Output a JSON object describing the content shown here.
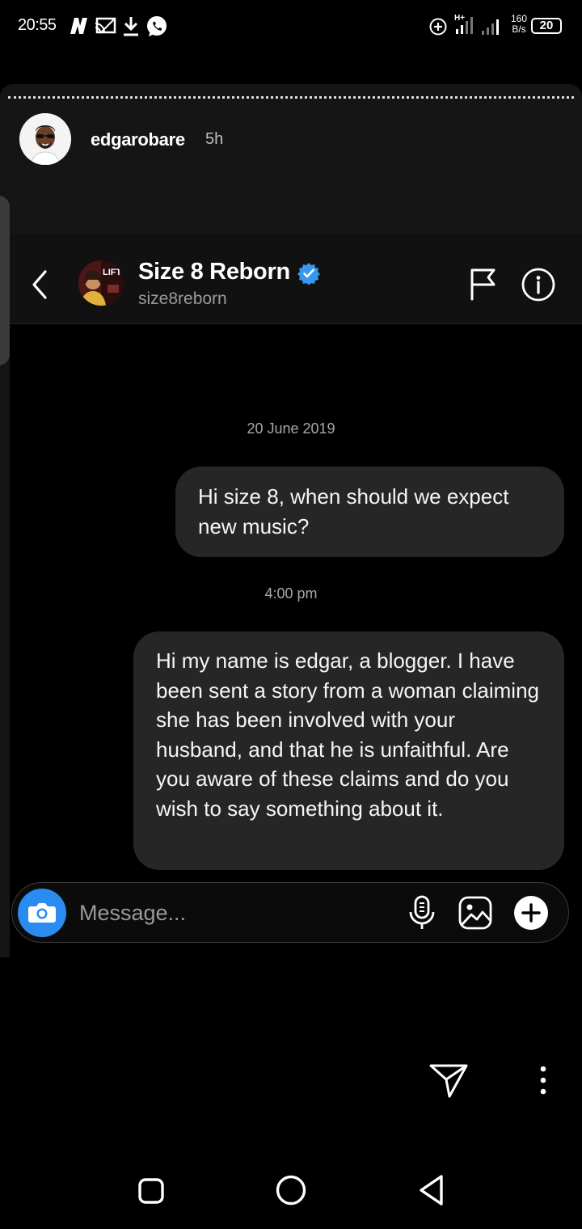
{
  "status_bar": {
    "time": "20:55",
    "network_speed_value": "160",
    "network_speed_unit": "B/s",
    "battery_level": "20",
    "left_icons": [
      "netflix-icon",
      "screen-cast-icon",
      "download-icon",
      "whatsapp-icon"
    ],
    "right_icons": [
      "data-saver-icon",
      "signal-icon",
      "signal-icon",
      "battery-icon"
    ]
  },
  "story": {
    "username": "edgarobare",
    "time_ago": "5h"
  },
  "dm_header": {
    "contact_name": "Size 8 Reborn",
    "contact_handle": "size8reborn",
    "avatar_text": "LIFT",
    "verified": true
  },
  "messages": {
    "date_stamp": "20 June 2019",
    "first": "Hi size 8, when should we expect new music?",
    "time_stamp": "4:00 pm",
    "second": "Hi my name is edgar, a blogger. I have been sent a story from a woman claiming she has been involved with your husband, and that he is unfaithful. Are you aware of these claims and do you wish to say something about it."
  },
  "composer": {
    "placeholder": "Message..."
  },
  "colors": {
    "camera_button": "#2a8cf0",
    "verified_badge": "#3897f0",
    "bubble": "#262626"
  }
}
